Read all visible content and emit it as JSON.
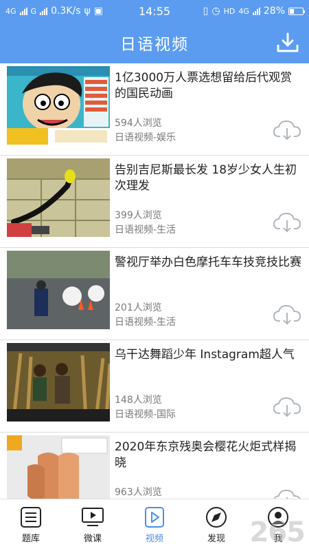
{
  "status_bar": {
    "left": "4G",
    "g_label": "G",
    "speed": "0.3K/s",
    "time": "14:55",
    "hd": "HD",
    "net": "4G",
    "battery": "28%"
  },
  "header": {
    "title": "日语视频",
    "download_icon": "download-icon"
  },
  "videos": [
    {
      "title": "1亿3000万人票选想留给后代观赏的国民动画",
      "views": "594人浏览",
      "category": "日语视频-娱乐"
    },
    {
      "title": "告别吉尼斯最长发 18岁少女人生初次理发",
      "views": "399人浏览",
      "category": "日语视频-生活"
    },
    {
      "title": "警视厅举办白色摩托车车技竞技比赛",
      "views": "201人浏览",
      "category": "日语视频-生活"
    },
    {
      "title": "乌干达舞蹈少年 Instagram超人气",
      "views": "148人浏览",
      "category": "日语视频-国际"
    },
    {
      "title": "2020年东京残奥会樱花火炬式样揭晓",
      "views": "963人浏览",
      "category": ""
    }
  ],
  "nav": [
    {
      "label": "题库",
      "icon": "list-icon"
    },
    {
      "label": "微课",
      "icon": "video-screen-icon"
    },
    {
      "label": "视频",
      "icon": "play-icon"
    },
    {
      "label": "发现",
      "icon": "compass-icon"
    },
    {
      "label": "我",
      "icon": "user-icon"
    }
  ],
  "watermark": "265",
  "colors": {
    "primary": "#5b9cf0",
    "active": "#4b8ee8",
    "meta_text": "#777777"
  }
}
